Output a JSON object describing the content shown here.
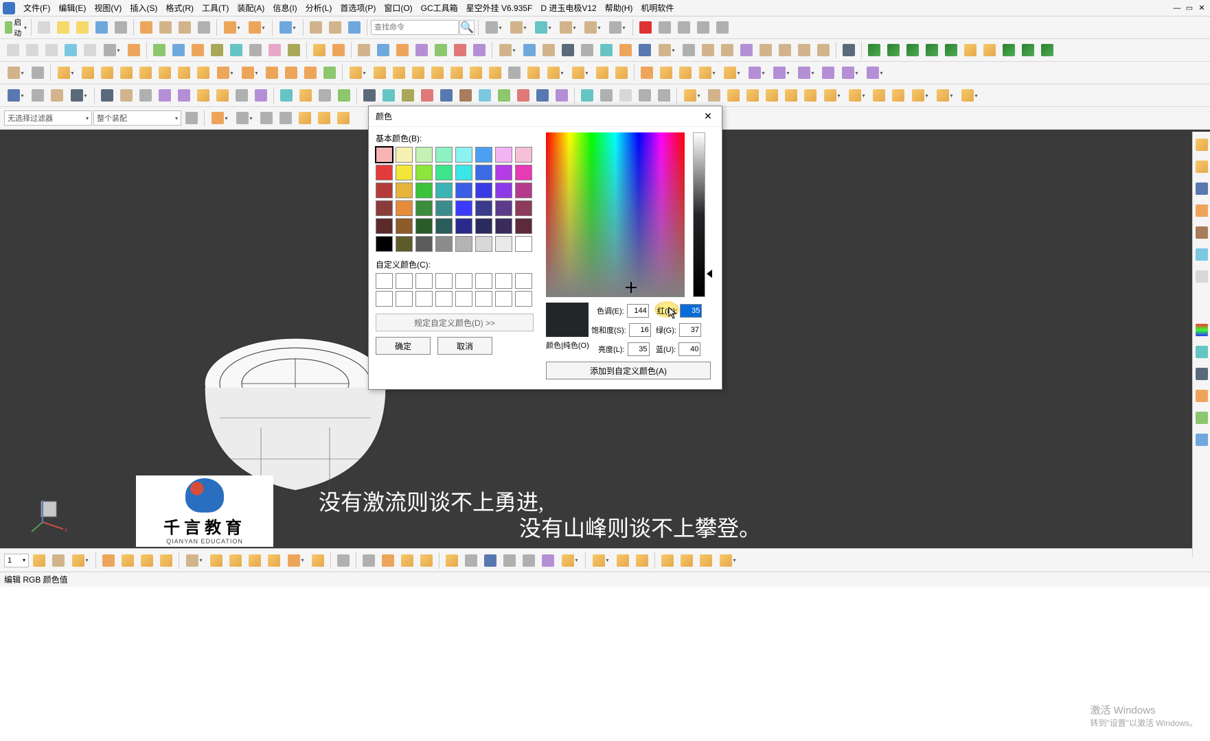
{
  "menubar": {
    "items": [
      "文件(F)",
      "编辑(E)",
      "视图(V)",
      "插入(S)",
      "格式(R)",
      "工具(T)",
      "装配(A)",
      "信息(I)",
      "分析(L)",
      "首选项(P)",
      "窗口(O)",
      "GC工具箱",
      "星空外挂 V6.935F",
      "D 进玉电极V12",
      "帮助(H)",
      "机明软件"
    ]
  },
  "toolbar1": {
    "start_label": "启动",
    "search_placeholder": "查找命令"
  },
  "filters": {
    "left": "无选择过滤器",
    "right": "整个装配"
  },
  "page": "1",
  "status_text": "编辑 RGB 颜色值",
  "activate": {
    "line1": "激活 Windows",
    "line2": "转到\"设置\"以激活 Windows。"
  },
  "caption": {
    "line1": "没有激流则谈不上勇进,",
    "line2": "没有山峰则谈不上攀登。"
  },
  "logo": {
    "zh": "千言教育",
    "en": "QIANYAN EDUCATION"
  },
  "dialog": {
    "title": "颜色",
    "basic_label": "基本颜色(B):",
    "custom_label": "自定义颜色(C):",
    "define_label": "规定自定义颜色(D) >>",
    "ok": "确定",
    "cancel": "取消",
    "preview_label": "颜色|纯色(O)",
    "hue_label": "色调(E):",
    "hue": "144",
    "sat_label": "饱和度(S):",
    "sat": "16",
    "lum_label": "亮度(L):",
    "lum": "35",
    "r_label": "红(R):",
    "r": "35",
    "g_label": "绿(G):",
    "g": "37",
    "b_label": "蓝(U):",
    "b": "40",
    "add_label": "添加到自定义颜色(A)",
    "basic_colors": [
      "#f7b4b4",
      "#f7f2b4",
      "#c4f2b4",
      "#8cf2c4",
      "#8cf2f2",
      "#4ca0f2",
      "#f2b4f2",
      "#f7c0d8",
      "#e33b3b",
      "#f2e63b",
      "#8ce63b",
      "#3be68c",
      "#3be6e6",
      "#3b6ce6",
      "#b43be6",
      "#e63bb4",
      "#b43b3b",
      "#e6b43b",
      "#3bc43b",
      "#3bb4b4",
      "#3b5ce6",
      "#3b3be6",
      "#8c3be6",
      "#b43b8c",
      "#8c3b3b",
      "#e68c3b",
      "#3b8c3b",
      "#3b8c8c",
      "#3b3bff",
      "#3b3b8c",
      "#5c3b8c",
      "#8c3b5c",
      "#5c2a2a",
      "#8c5c2a",
      "#2a5c2a",
      "#2a5c5c",
      "#2a2a8c",
      "#2a2a5c",
      "#3b2a5c",
      "#5c2a3b",
      "#000000",
      "#5c5c2a",
      "#5c5c5c",
      "#8c8c8c",
      "#b4b4b4",
      "#d8d8d8",
      "#eaeaea",
      "#ffffff"
    ]
  }
}
